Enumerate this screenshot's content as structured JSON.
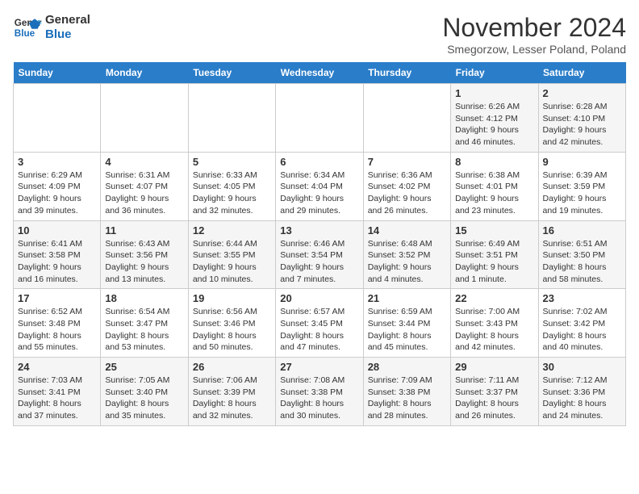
{
  "logo": {
    "line1": "General",
    "line2": "Blue"
  },
  "title": "November 2024",
  "location": "Smegorzow, Lesser Poland, Poland",
  "weekdays": [
    "Sunday",
    "Monday",
    "Tuesday",
    "Wednesday",
    "Thursday",
    "Friday",
    "Saturday"
  ],
  "weeks": [
    [
      {
        "day": "",
        "info": ""
      },
      {
        "day": "",
        "info": ""
      },
      {
        "day": "",
        "info": ""
      },
      {
        "day": "",
        "info": ""
      },
      {
        "day": "",
        "info": ""
      },
      {
        "day": "1",
        "info": "Sunrise: 6:26 AM\nSunset: 4:12 PM\nDaylight: 9 hours and 46 minutes."
      },
      {
        "day": "2",
        "info": "Sunrise: 6:28 AM\nSunset: 4:10 PM\nDaylight: 9 hours and 42 minutes."
      }
    ],
    [
      {
        "day": "3",
        "info": "Sunrise: 6:29 AM\nSunset: 4:09 PM\nDaylight: 9 hours and 39 minutes."
      },
      {
        "day": "4",
        "info": "Sunrise: 6:31 AM\nSunset: 4:07 PM\nDaylight: 9 hours and 36 minutes."
      },
      {
        "day": "5",
        "info": "Sunrise: 6:33 AM\nSunset: 4:05 PM\nDaylight: 9 hours and 32 minutes."
      },
      {
        "day": "6",
        "info": "Sunrise: 6:34 AM\nSunset: 4:04 PM\nDaylight: 9 hours and 29 minutes."
      },
      {
        "day": "7",
        "info": "Sunrise: 6:36 AM\nSunset: 4:02 PM\nDaylight: 9 hours and 26 minutes."
      },
      {
        "day": "8",
        "info": "Sunrise: 6:38 AM\nSunset: 4:01 PM\nDaylight: 9 hours and 23 minutes."
      },
      {
        "day": "9",
        "info": "Sunrise: 6:39 AM\nSunset: 3:59 PM\nDaylight: 9 hours and 19 minutes."
      }
    ],
    [
      {
        "day": "10",
        "info": "Sunrise: 6:41 AM\nSunset: 3:58 PM\nDaylight: 9 hours and 16 minutes."
      },
      {
        "day": "11",
        "info": "Sunrise: 6:43 AM\nSunset: 3:56 PM\nDaylight: 9 hours and 13 minutes."
      },
      {
        "day": "12",
        "info": "Sunrise: 6:44 AM\nSunset: 3:55 PM\nDaylight: 9 hours and 10 minutes."
      },
      {
        "day": "13",
        "info": "Sunrise: 6:46 AM\nSunset: 3:54 PM\nDaylight: 9 hours and 7 minutes."
      },
      {
        "day": "14",
        "info": "Sunrise: 6:48 AM\nSunset: 3:52 PM\nDaylight: 9 hours and 4 minutes."
      },
      {
        "day": "15",
        "info": "Sunrise: 6:49 AM\nSunset: 3:51 PM\nDaylight: 9 hours and 1 minute."
      },
      {
        "day": "16",
        "info": "Sunrise: 6:51 AM\nSunset: 3:50 PM\nDaylight: 8 hours and 58 minutes."
      }
    ],
    [
      {
        "day": "17",
        "info": "Sunrise: 6:52 AM\nSunset: 3:48 PM\nDaylight: 8 hours and 55 minutes."
      },
      {
        "day": "18",
        "info": "Sunrise: 6:54 AM\nSunset: 3:47 PM\nDaylight: 8 hours and 53 minutes."
      },
      {
        "day": "19",
        "info": "Sunrise: 6:56 AM\nSunset: 3:46 PM\nDaylight: 8 hours and 50 minutes."
      },
      {
        "day": "20",
        "info": "Sunrise: 6:57 AM\nSunset: 3:45 PM\nDaylight: 8 hours and 47 minutes."
      },
      {
        "day": "21",
        "info": "Sunrise: 6:59 AM\nSunset: 3:44 PM\nDaylight: 8 hours and 45 minutes."
      },
      {
        "day": "22",
        "info": "Sunrise: 7:00 AM\nSunset: 3:43 PM\nDaylight: 8 hours and 42 minutes."
      },
      {
        "day": "23",
        "info": "Sunrise: 7:02 AM\nSunset: 3:42 PM\nDaylight: 8 hours and 40 minutes."
      }
    ],
    [
      {
        "day": "24",
        "info": "Sunrise: 7:03 AM\nSunset: 3:41 PM\nDaylight: 8 hours and 37 minutes."
      },
      {
        "day": "25",
        "info": "Sunrise: 7:05 AM\nSunset: 3:40 PM\nDaylight: 8 hours and 35 minutes."
      },
      {
        "day": "26",
        "info": "Sunrise: 7:06 AM\nSunset: 3:39 PM\nDaylight: 8 hours and 32 minutes."
      },
      {
        "day": "27",
        "info": "Sunrise: 7:08 AM\nSunset: 3:38 PM\nDaylight: 8 hours and 30 minutes."
      },
      {
        "day": "28",
        "info": "Sunrise: 7:09 AM\nSunset: 3:38 PM\nDaylight: 8 hours and 28 minutes."
      },
      {
        "day": "29",
        "info": "Sunrise: 7:11 AM\nSunset: 3:37 PM\nDaylight: 8 hours and 26 minutes."
      },
      {
        "day": "30",
        "info": "Sunrise: 7:12 AM\nSunset: 3:36 PM\nDaylight: 8 hours and 24 minutes."
      }
    ]
  ]
}
